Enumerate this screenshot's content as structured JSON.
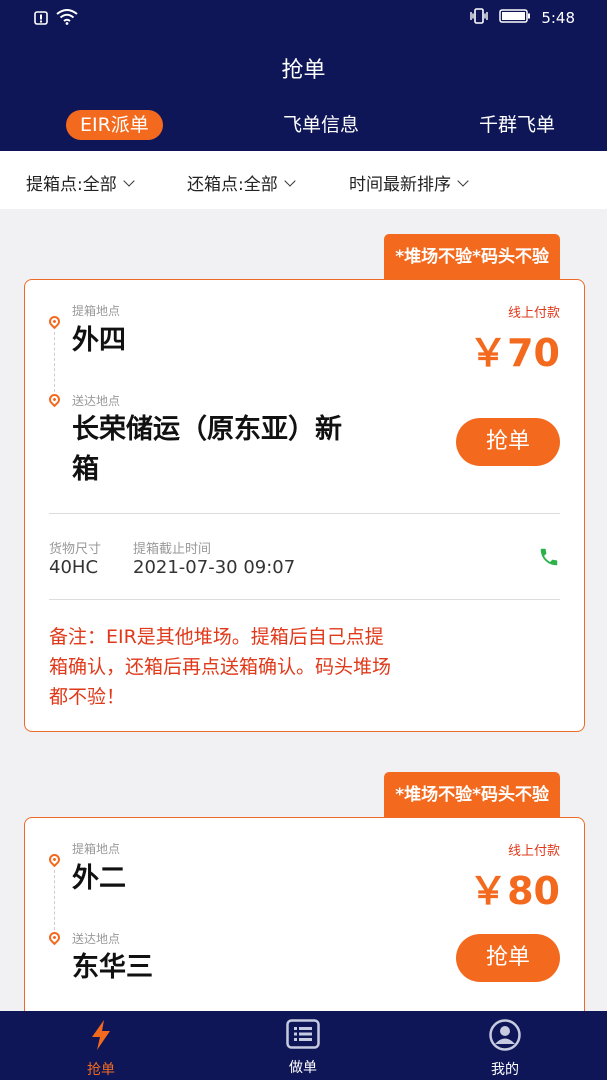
{
  "status_bar": {
    "time": "5:48"
  },
  "header": {
    "title": "抢单"
  },
  "tabs": [
    {
      "label": "EIR派单",
      "active": true
    },
    {
      "label": "飞单信息",
      "active": false
    },
    {
      "label": "千群飞单",
      "active": false
    }
  ],
  "filters": [
    {
      "label": "提箱点:全部"
    },
    {
      "label": "还箱点:全部"
    },
    {
      "label": "时间最新排序"
    }
  ],
  "cards": [
    {
      "tag": "*堆场不验*码头不验",
      "pickup_label": "提箱地点",
      "pickup": "外四",
      "delivery_label": "送达地点",
      "delivery_line1": "长荣储运（原东亚）新",
      "delivery_line2": "箱",
      "pay_label": "线上付款",
      "price": "￥70",
      "grab": "抢单",
      "size_label": "货物尺寸",
      "size": "40HC",
      "deadline_label": "提箱截止时间",
      "deadline": "2021-07-30 09:07",
      "note_line1": "备注：EIR是其他堆场。提箱后自己点提",
      "note_line2": "箱确认，还箱后再点送箱确认。码头堆场",
      "note_line3": "都不验！"
    },
    {
      "tag": "*堆场不验*码头不验",
      "pickup_label": "提箱地点",
      "pickup": "外二",
      "delivery_label": "送达地点",
      "delivery_line1": "东华三",
      "pay_label": "线上付款",
      "price": "￥80",
      "grab": "抢单"
    }
  ],
  "bottom_nav": [
    {
      "label": "抢单",
      "icon": "lightning-icon",
      "active": true
    },
    {
      "label": "做单",
      "icon": "list-icon",
      "active": false
    },
    {
      "label": "我的",
      "icon": "user-icon",
      "active": false
    }
  ],
  "colors": {
    "navy": "#0e1657",
    "accent": "#f36a1f",
    "note": "#e0391a"
  }
}
